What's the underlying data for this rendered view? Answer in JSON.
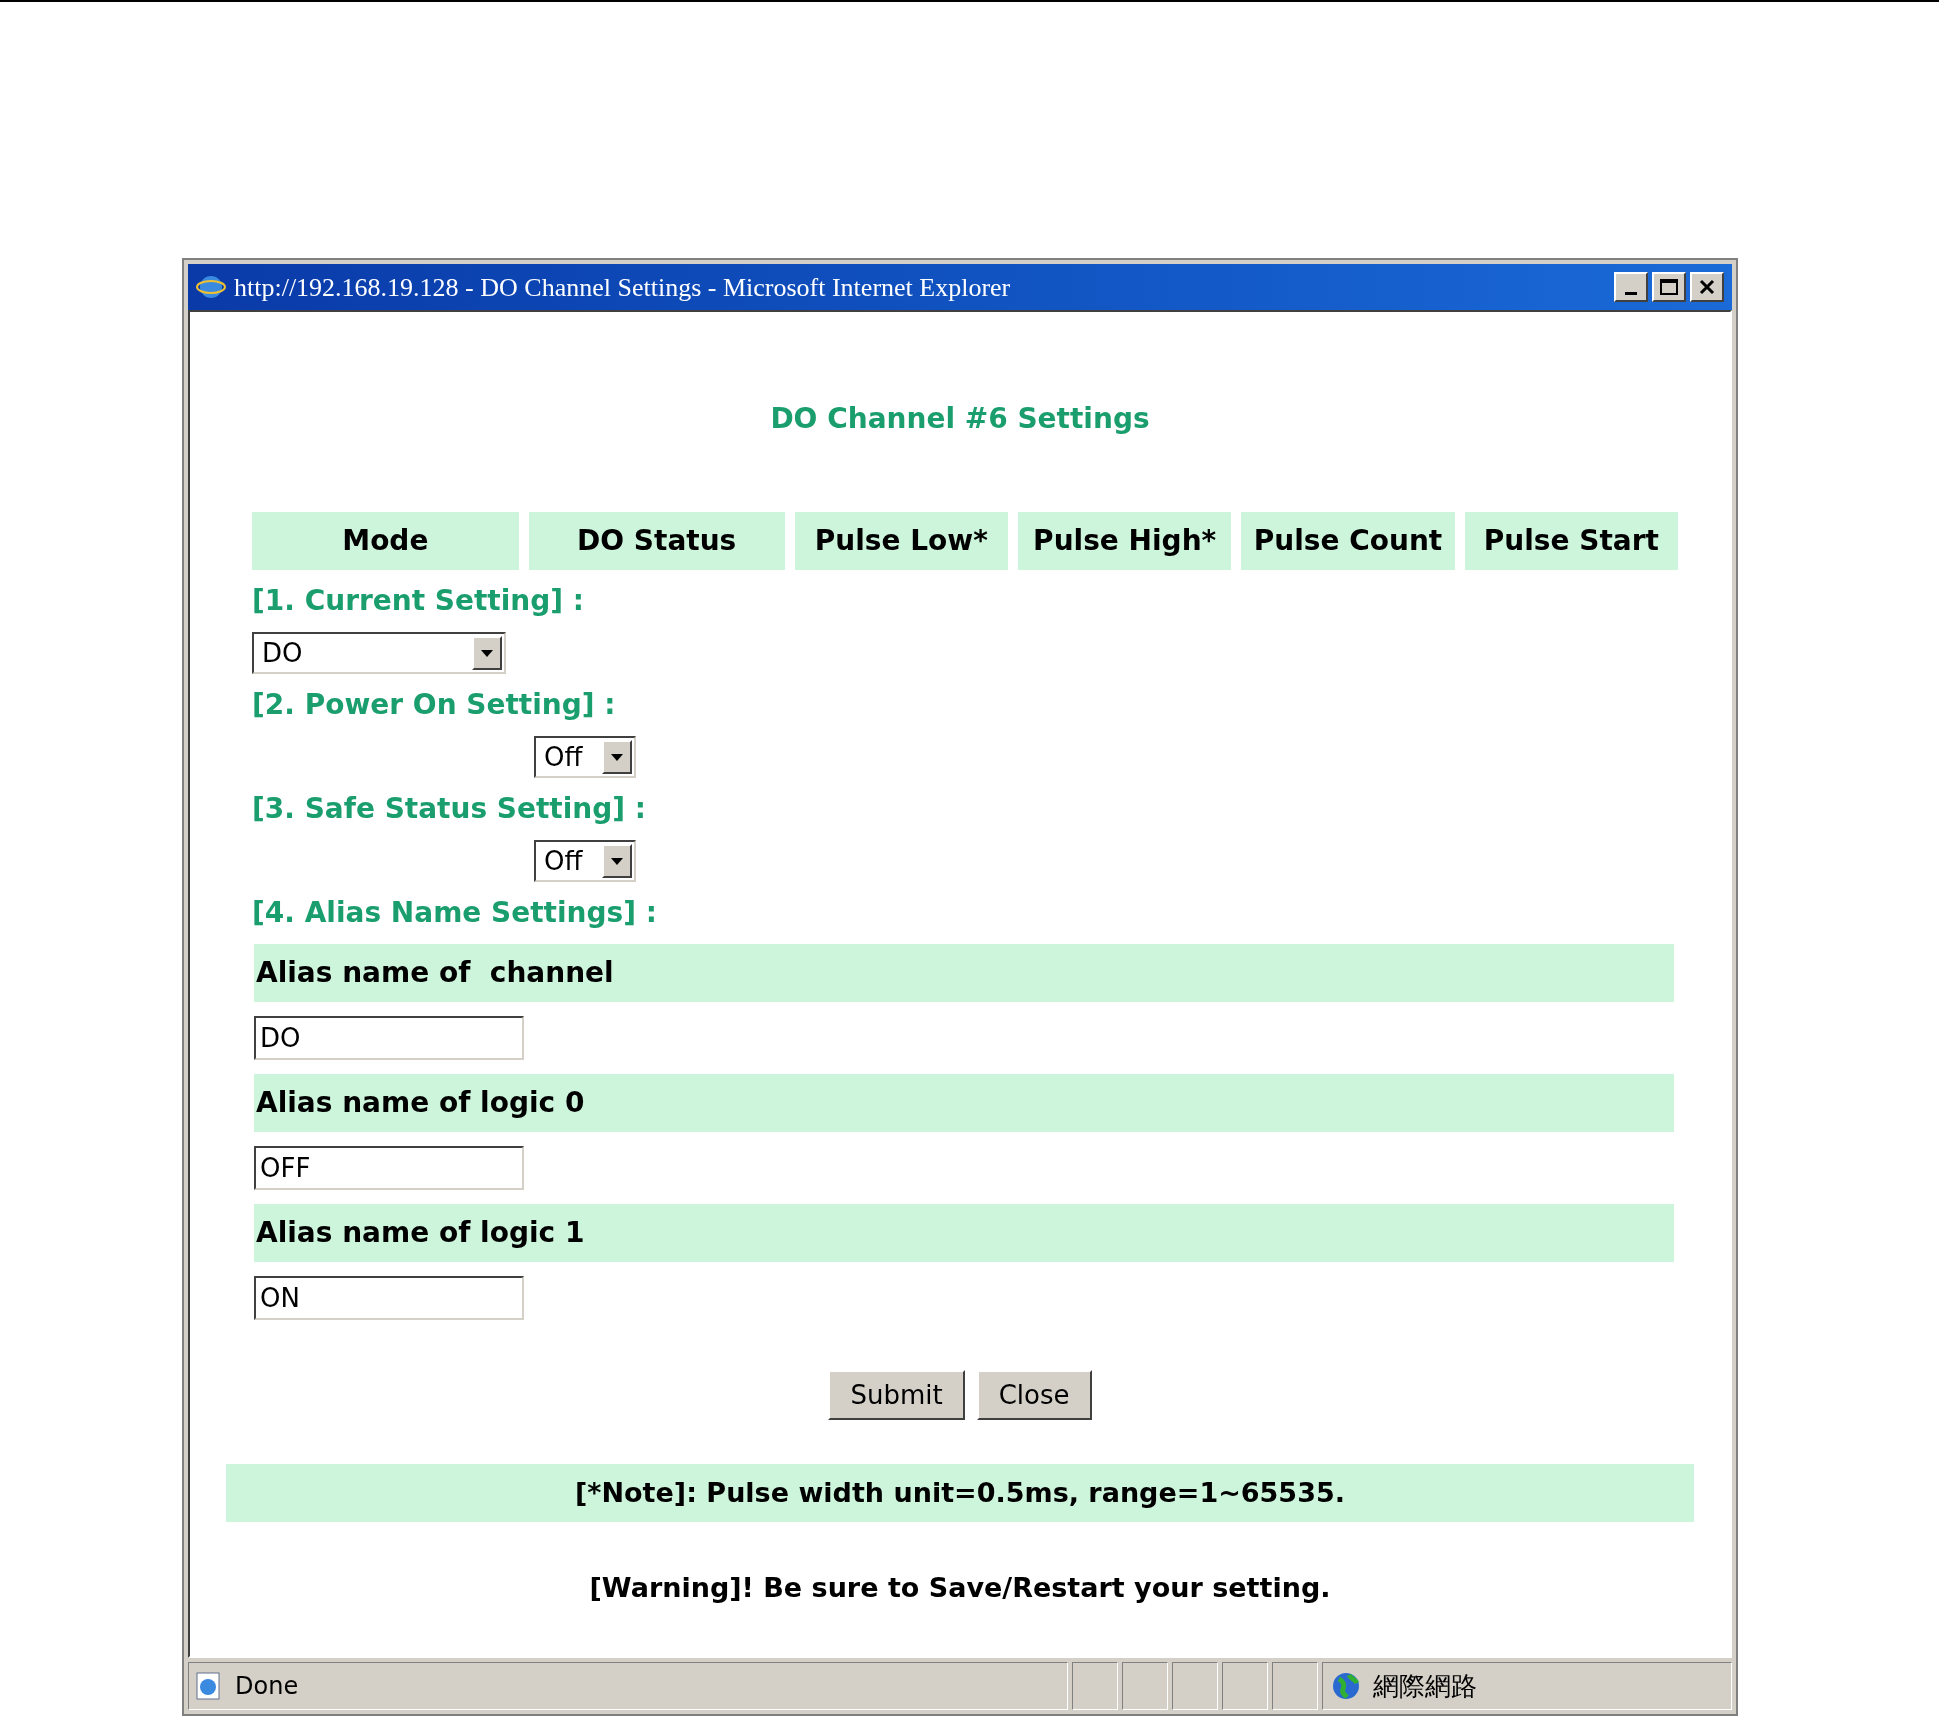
{
  "window": {
    "title": "http://192.168.19.128 - DO Channel Settings - Microsoft Internet Explorer"
  },
  "heading": "DO Channel #6 Settings",
  "columns": [
    "Mode",
    "DO Status",
    "Pulse Low*",
    "Pulse High*",
    "Pulse Count",
    "Pulse Start"
  ],
  "sections": [
    {
      "kind": "mode",
      "label": "[1. Current Setting] :",
      "value": "DO"
    },
    {
      "kind": "state",
      "label": "[2. Power On Setting] :",
      "value": "Off"
    },
    {
      "kind": "state",
      "label": "[3. Safe Status Setting] :",
      "value": "Off"
    },
    {
      "kind": "alias",
      "label": "[4. Alias Name Settings] :",
      "fields": [
        {
          "label": "Alias name of  channel",
          "value": "DO"
        },
        {
          "label": "Alias name of logic 0",
          "value": "OFF"
        },
        {
          "label": "Alias name of logic 1",
          "value": "ON"
        }
      ]
    }
  ],
  "buttons": [
    "Submit",
    "Close"
  ],
  "note": "[*Note]: Pulse width unit=0.5ms, range=1~65535.",
  "warning": "[Warning]! Be sure to Save/Restart your setting.",
  "status_bar": {
    "text": "Done",
    "zone": "網際網路"
  }
}
